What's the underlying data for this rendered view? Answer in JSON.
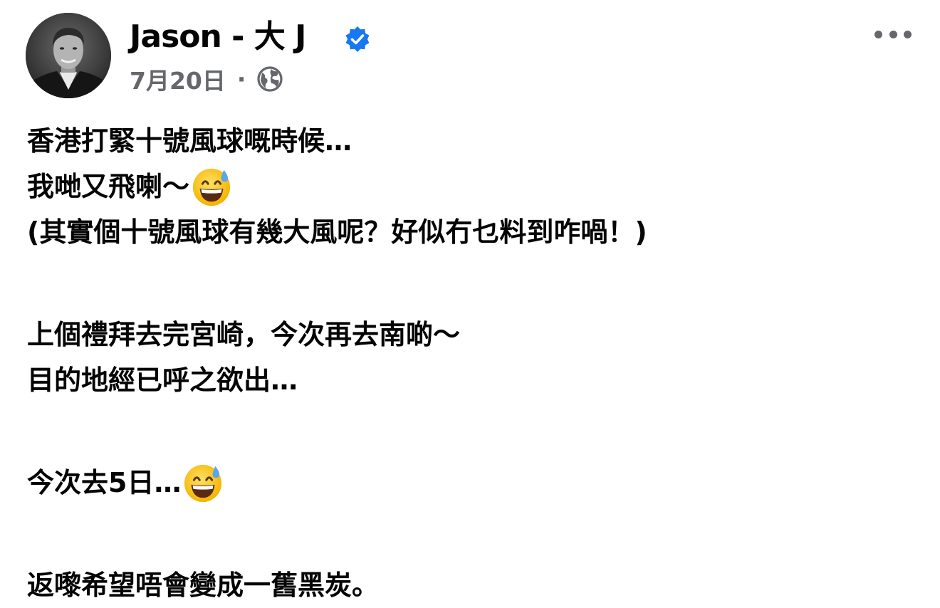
{
  "post": {
    "author": {
      "name": "Jason - 大 J",
      "verified_icon": "verified-badge-icon",
      "avatar": "profile-photo"
    },
    "meta": {
      "date": "7月20日",
      "separator": "·",
      "audience_icon": "globe-icon"
    },
    "menu_icon": "more-options-icon",
    "body": {
      "line1": "香港打緊十號風球嘅時候…",
      "line2": "我哋又飛喇～",
      "line3": "(其實個十號風球有幾大風呢？好似冇乜料到咋喎！)",
      "line4": "上個禮拜去完宮崎，今次再去南啲～",
      "line5": "目的地經已呼之欲出…",
      "line6": "今次去5日…",
      "line7": "返嚟希望唔會變成一舊黑炭。"
    },
    "emoji_name": "grinning-face-with-sweat"
  },
  "colors": {
    "text_primary": "#050505",
    "text_secondary": "#65676b",
    "verified_blue": "#1877f2",
    "background": "#ffffff"
  }
}
